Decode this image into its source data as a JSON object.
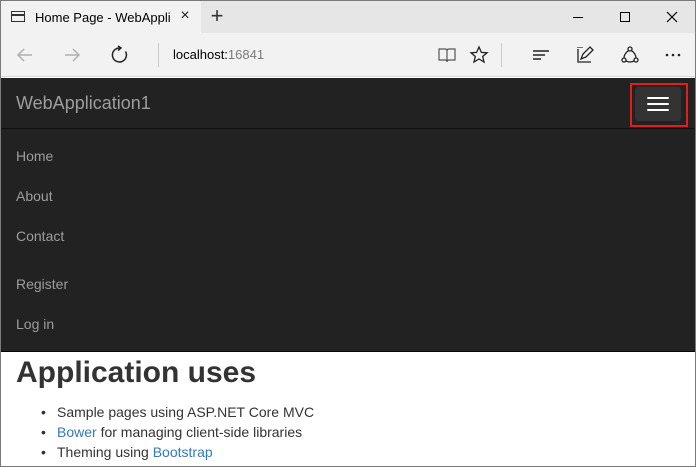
{
  "browser": {
    "tab_title": "Home Page - WebApplic",
    "tab_close": "×",
    "new_tab": "+",
    "address_host": "localhost:",
    "address_port": "16841"
  },
  "site": {
    "brand": "WebApplication1",
    "nav_links": [
      "Home",
      "About",
      "Contact"
    ],
    "account_links": [
      "Register",
      "Log in"
    ]
  },
  "content": {
    "heading": "Application uses",
    "items": [
      {
        "text": "Sample pages using ASP.NET Core MVC"
      },
      {
        "link": "Bower",
        "text": " for managing client-side libraries"
      },
      {
        "prefix": "Theming using ",
        "link": "Bootstrap"
      }
    ]
  },
  "colors": {
    "navbar_bg": "#222222",
    "nav_text": "#9d9d9d",
    "link": "#337ab7",
    "highlight": "#e31d1d"
  },
  "icons": [
    "tab-page-icon",
    "back-icon",
    "forward-icon",
    "refresh-icon",
    "reading-view-icon",
    "favorites-star-icon",
    "hub-icon",
    "web-note-icon",
    "share-icon",
    "more-icon",
    "hamburger-menu-icon"
  ]
}
